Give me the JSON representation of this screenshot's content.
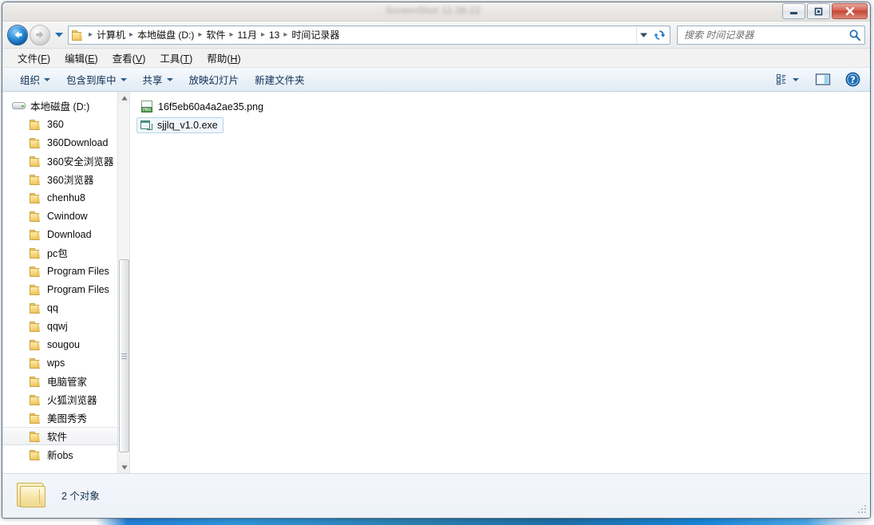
{
  "window": {
    "ghost_title": "ScreenShot 11:38:22",
    "buttons": {
      "minimize": "minimize-button",
      "maximize": "maximize-button",
      "close": "close-button"
    }
  },
  "address": {
    "back_tooltip": "后退",
    "forward_tooltip": "前进",
    "breadcrumb": [
      "计算机",
      "本地磁盘 (D:)",
      "软件",
      "11月",
      "13",
      "时间记录器"
    ],
    "separator": "▸",
    "refresh_tooltip": "刷新"
  },
  "search": {
    "placeholder": "搜索 时间记录器",
    "value": ""
  },
  "menu": {
    "items": [
      {
        "text": "文件",
        "accel": "F"
      },
      {
        "text": "编辑",
        "accel": "E"
      },
      {
        "text": "查看",
        "accel": "V"
      },
      {
        "text": "工具",
        "accel": "T"
      },
      {
        "text": "帮助",
        "accel": "H"
      }
    ]
  },
  "toolbar": {
    "items": [
      {
        "label": "组织",
        "has_caret": true
      },
      {
        "label": "包含到库中",
        "has_caret": true
      },
      {
        "label": "共享",
        "has_caret": true
      },
      {
        "label": "放映幻灯片",
        "has_caret": false
      },
      {
        "label": "新建文件夹",
        "has_caret": false
      }
    ],
    "view_icon": "view-options-icon",
    "preview_icon": "preview-pane-icon",
    "help_icon": "help-icon"
  },
  "nav_pane": {
    "root": {
      "label": "本地磁盘 (D:)",
      "icon": "drive-icon"
    },
    "items": [
      {
        "label": "360",
        "selected": false
      },
      {
        "label": "360Download",
        "selected": false
      },
      {
        "label": "360安全浏览器",
        "selected": false
      },
      {
        "label": "360浏览器",
        "selected": false
      },
      {
        "label": "chenhu8",
        "selected": false
      },
      {
        "label": "Cwindow",
        "selected": false
      },
      {
        "label": "Download",
        "selected": false
      },
      {
        "label": "pc包",
        "selected": false
      },
      {
        "label": "Program Files",
        "selected": false
      },
      {
        "label": "Program Files",
        "selected": false
      },
      {
        "label": "qq",
        "selected": false
      },
      {
        "label": "qqwj",
        "selected": false
      },
      {
        "label": "sougou",
        "selected": false
      },
      {
        "label": "wps",
        "selected": false
      },
      {
        "label": "电脑管家",
        "selected": false
      },
      {
        "label": "火狐浏览器",
        "selected": false
      },
      {
        "label": "美图秀秀",
        "selected": false
      },
      {
        "label": "软件",
        "selected": true
      },
      {
        "label": "新obs",
        "selected": false
      }
    ]
  },
  "files": [
    {
      "name": "16f5eb60a4a2ae35.png",
      "icon": "png-file-icon",
      "selected": false
    },
    {
      "name": "sjjlq_v1.0.exe",
      "icon": "exe-file-icon",
      "selected": true
    }
  ],
  "status": {
    "text": "2 个对象",
    "icon": "folder-icon"
  }
}
